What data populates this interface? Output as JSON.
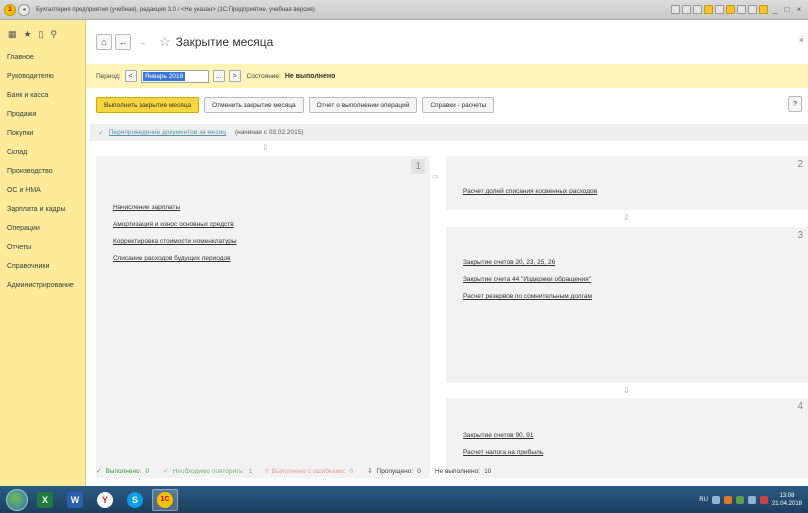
{
  "window": {
    "title": "Бухгалтерия предприятия (учебная), редакция 3.0 / <Не указан>  (1С:Предприятие, учебная версия)",
    "controls": [
      "_",
      "□",
      "×"
    ]
  },
  "sidebar": {
    "items": [
      {
        "label": "Главное"
      },
      {
        "label": "Руководителю"
      },
      {
        "label": "Банк и касса"
      },
      {
        "label": "Продажи"
      },
      {
        "label": "Покупки"
      },
      {
        "label": "Склад"
      },
      {
        "label": "Производство"
      },
      {
        "label": "ОС и НМА"
      },
      {
        "label": "Зарплата и кадры"
      },
      {
        "label": "Операции"
      },
      {
        "label": "Отчеты"
      },
      {
        "label": "Справочники"
      },
      {
        "label": "Администрирование"
      }
    ]
  },
  "header": {
    "title": "Закрытие месяца"
  },
  "period": {
    "label": "Период:",
    "value": "Январь 2018",
    "dots": "...",
    "state_label": "Состояние:",
    "state_value": "Не выполнено"
  },
  "actions": {
    "close_month": "Выполнить закрытие месяца",
    "cancel_close": "Отменить закрытие месяца",
    "report": "Отчет о выполнении операций",
    "calc_help": "Справки - расчеты",
    "help": "?"
  },
  "repost": {
    "link": "Перепроведение документов за месяц",
    "since": "(начиная с 03.02.2015)"
  },
  "panels": [
    {
      "number": "1",
      "items": [
        "Начисление зарплаты",
        "Амортизация и износ основных средств",
        "Корректировка стоимости номенклатуры",
        "Списание расходов будущих периодов"
      ]
    },
    {
      "number": "2",
      "items": [
        "Расчет долей списания косвенных расходов"
      ]
    },
    {
      "number": "3",
      "items": [
        "Закрытие счетов 20, 23, 25, 26",
        "Закрытие счета 44 \"Издержки обращения\"",
        "Расчет резервов по сомнительным долгам"
      ]
    },
    {
      "number": "4",
      "items": [
        "Закрытие счетов 90, 91",
        "Расчет налога на прибыль"
      ]
    }
  ],
  "status": {
    "done_label": "Выполнено:",
    "done_count": "0",
    "repeat_label": "Необходимо повторить:",
    "repeat_count": "1",
    "errors_label": "Выполнено с ошибками:",
    "errors_count": "0",
    "skipped_label": "Пропущено:",
    "skipped_count": "0",
    "notdone_label": "Не выполнено:",
    "notdone_count": "10"
  },
  "taskbar": {
    "lang": "RU",
    "time": "13:08",
    "date": "21.04.2018"
  }
}
